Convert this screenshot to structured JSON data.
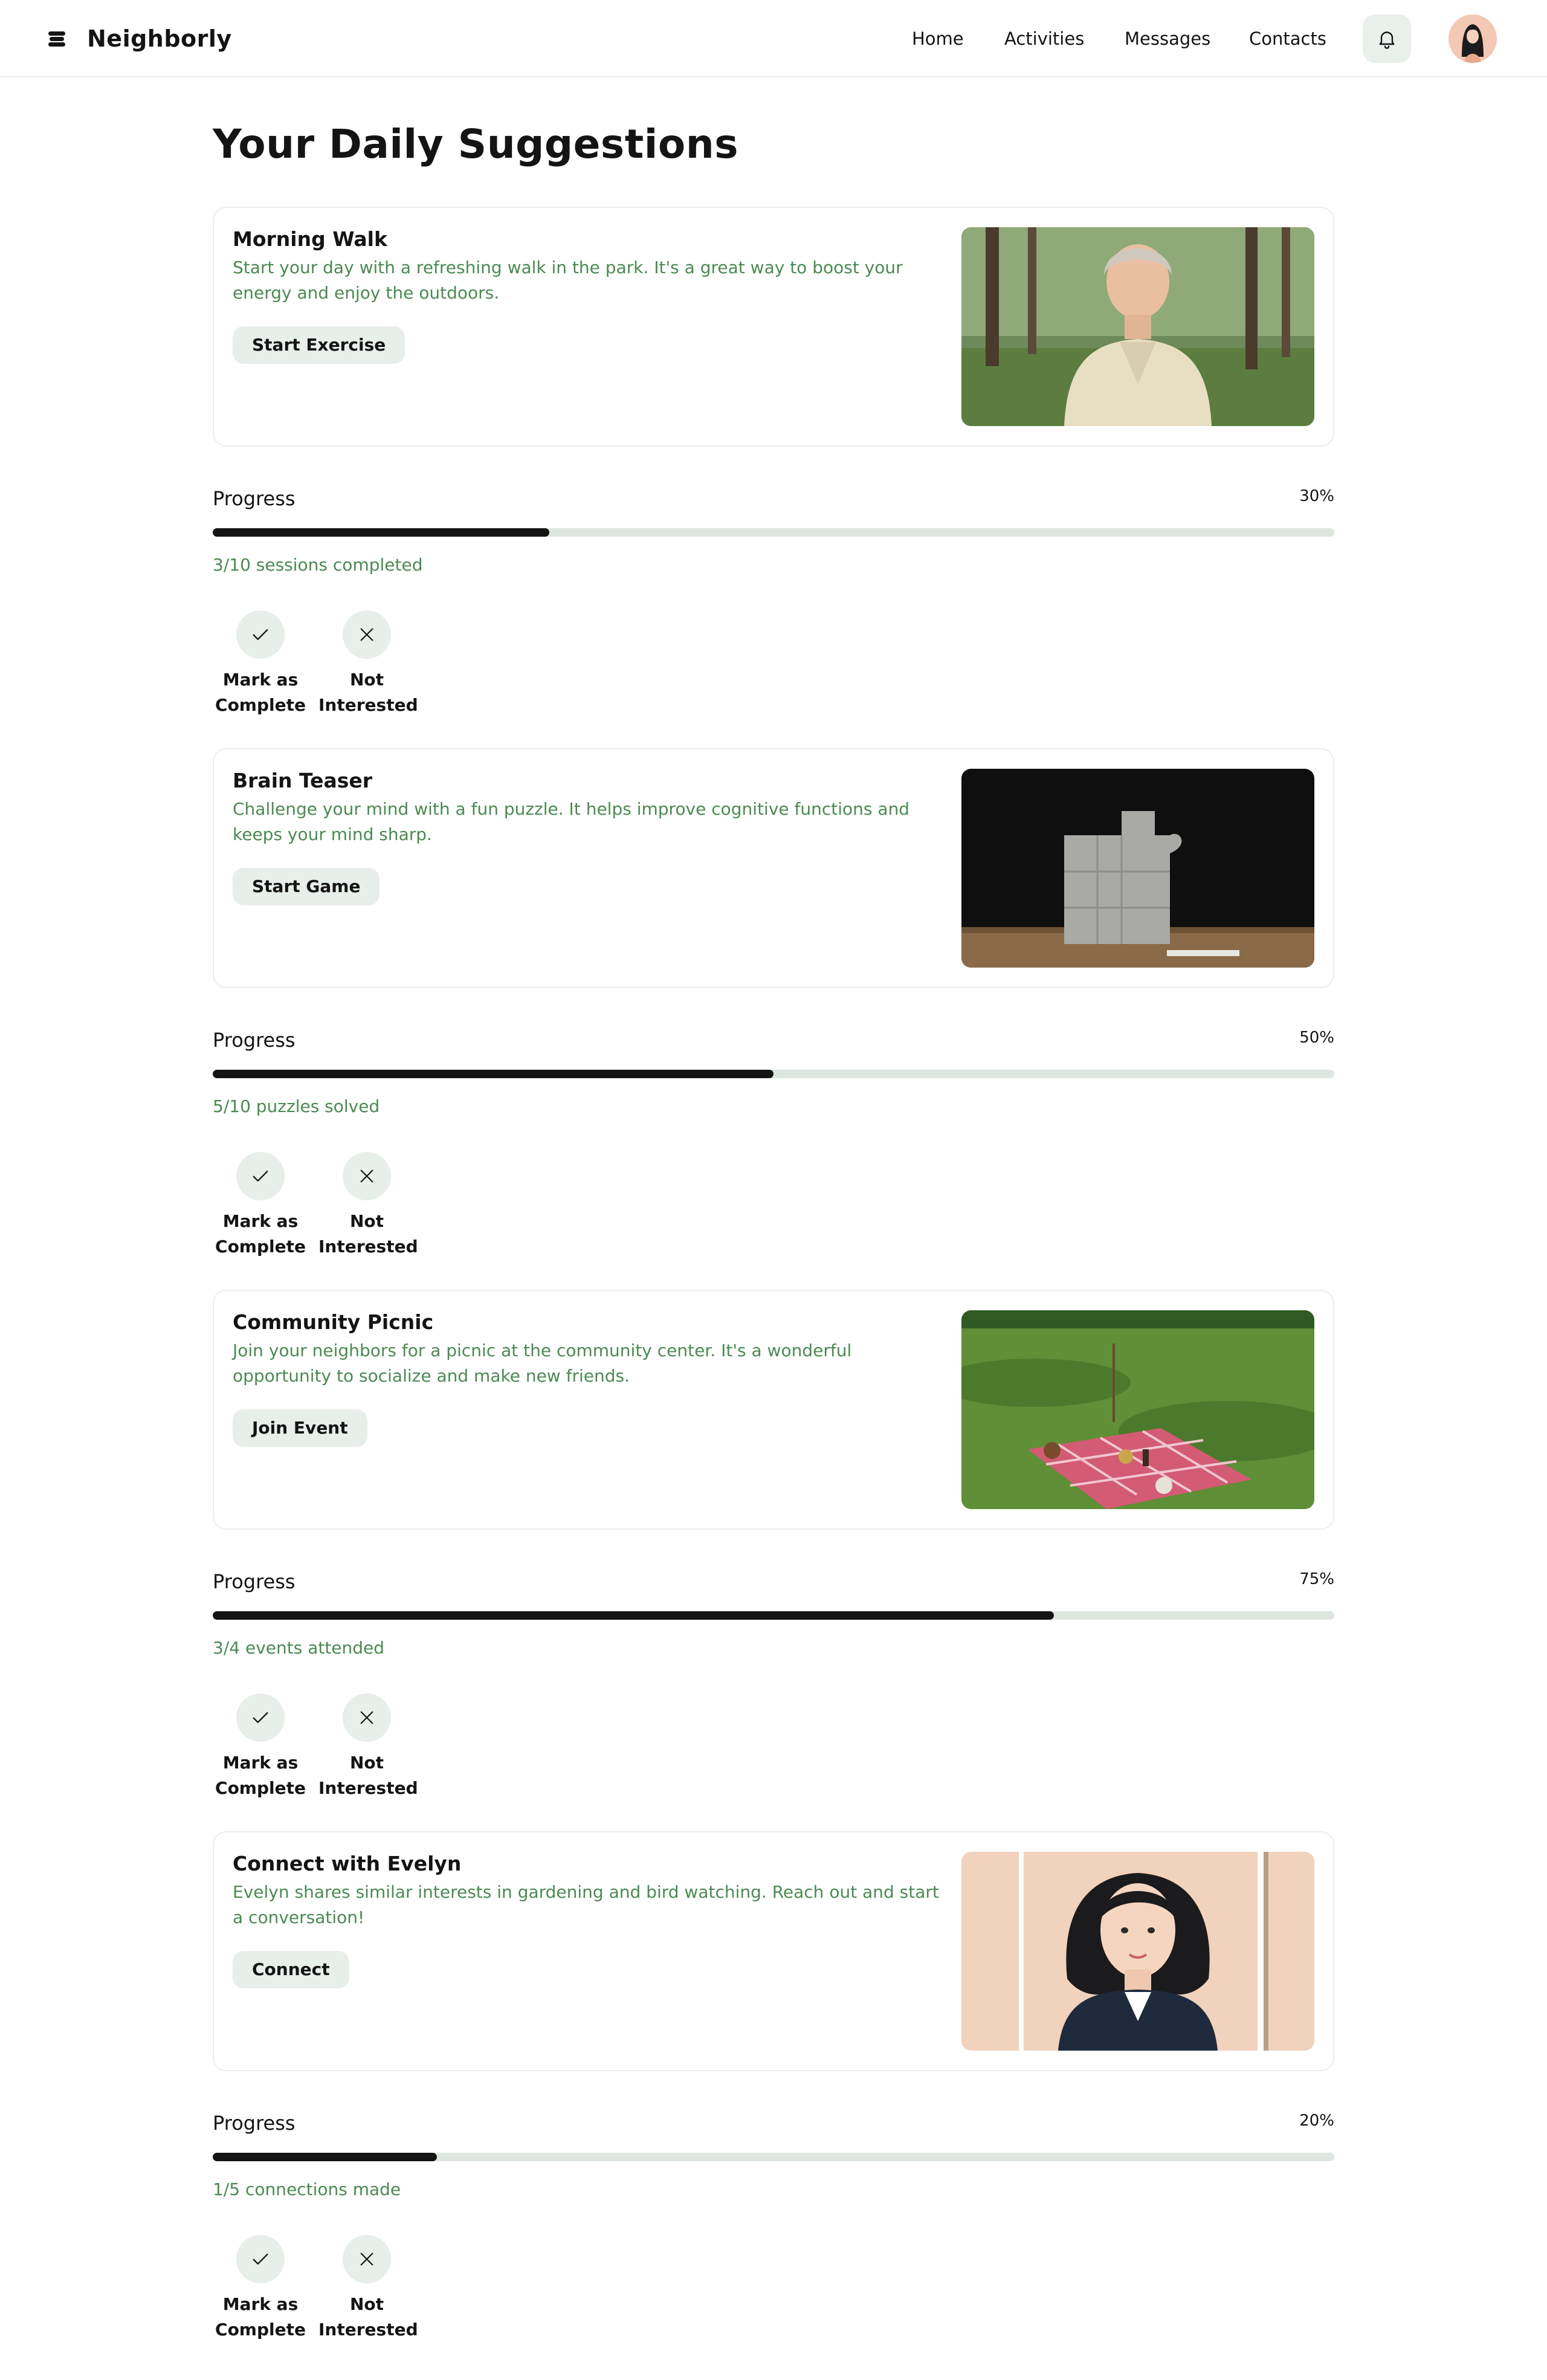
{
  "app": {
    "name": "Neighborly",
    "brand_icon": "stacked-layers-icon"
  },
  "nav": {
    "items": [
      "Home",
      "Activities",
      "Messages",
      "Contacts"
    ],
    "notification_icon": "bell-icon",
    "avatar": "user-avatar"
  },
  "page": {
    "title": "Your Daily Suggestions"
  },
  "colors": {
    "accent_green": "#4b8a52",
    "button_bg": "#e8eeea",
    "progress_track": "#dde6df",
    "progress_fill": "#141414"
  },
  "suggestions": [
    {
      "title": "Morning Walk",
      "description": "Start your day with a refreshing walk in the park. It's a great way to boost your energy and enjoy the outdoors.",
      "button": "Start Exercise",
      "image": "older-woman-in-park-photo",
      "progress_label": "Progress",
      "progress_percent": "30%",
      "progress_value": 30,
      "progress_note": "3/10 sessions completed",
      "complete_label": "Mark as Complete",
      "dismiss_label": "Not Interested"
    },
    {
      "title": "Brain Teaser",
      "description": "Challenge your mind with a fun puzzle. It helps improve cognitive functions and keeps your mind sharp.",
      "button": "Start Game",
      "image": "jigsaw-puzzle-photo",
      "progress_label": "Progress",
      "progress_percent": "50%",
      "progress_value": 50,
      "progress_note": "5/10 puzzles solved",
      "complete_label": "Mark as Complete",
      "dismiss_label": "Not Interested"
    },
    {
      "title": "Community Picnic",
      "description": "Join your neighbors for a picnic at the community center. It's a wonderful opportunity to socialize and make new friends.",
      "button": "Join Event",
      "image": "picnic-blanket-on-lawn-photo",
      "progress_label": "Progress",
      "progress_percent": "75%",
      "progress_value": 75,
      "progress_note": "3/4 events attended",
      "complete_label": "Mark as Complete",
      "dismiss_label": "Not Interested"
    },
    {
      "title": "Connect with Evelyn",
      "description": "Evelyn shares similar interests in gardening and bird watching. Reach out and start a conversation!",
      "button": "Connect",
      "image": "evelyn-portrait-illustration",
      "progress_label": "Progress",
      "progress_percent": "20%",
      "progress_value": 20,
      "progress_note": "1/5 connections made",
      "complete_label": "Mark as Complete",
      "dismiss_label": "Not Interested"
    }
  ]
}
